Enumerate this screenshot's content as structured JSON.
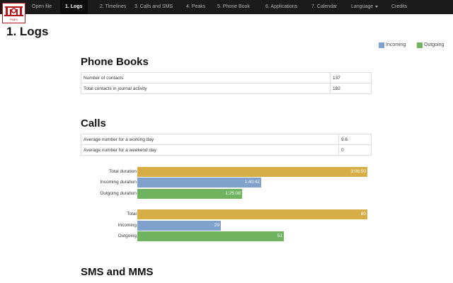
{
  "navbar": {
    "logo_text": "PhiEX",
    "items": [
      {
        "label": "Open file"
      },
      {
        "label": "1. Logs"
      },
      {
        "label": "2. Timelines"
      },
      {
        "label": "3. Calls and SMS"
      },
      {
        "label": "4. Peaks"
      },
      {
        "label": "5. Phone Book"
      },
      {
        "label": "6. Applications"
      },
      {
        "label": "7. Calendar"
      },
      {
        "label": "Language"
      },
      {
        "label": "Credits"
      }
    ],
    "active_index": 1
  },
  "page": {
    "title": "1. Logs"
  },
  "legend": {
    "items": [
      {
        "label": "Incoming",
        "color": "#7fa1cc"
      },
      {
        "label": "Outgoing",
        "color": "#6fb35f"
      }
    ]
  },
  "phone_books": {
    "heading": "Phone Books",
    "rows": [
      {
        "label": "Number of contacts",
        "value": "137"
      },
      {
        "label": "Total contacts in journal activity",
        "value": "182"
      }
    ]
  },
  "calls": {
    "heading": "Calls",
    "rows": [
      {
        "label": "Average number for a working day",
        "value": "9.6"
      },
      {
        "label": "Average number for a weekend day",
        "value": "0"
      }
    ],
    "duration_bars": [
      {
        "label": "Total duration",
        "value": "3:06:50",
        "fraction": 1.0,
        "color": "#d6ae45"
      },
      {
        "label": "Incoming duration",
        "value": "1:40:42",
        "fraction": 0.539,
        "color": "#7fa1cc"
      },
      {
        "label": "Outgoing duration",
        "value": "1:25:08",
        "fraction": 0.456,
        "color": "#6fb35f"
      }
    ],
    "count_bars": [
      {
        "label": "Total",
        "value": "80",
        "fraction": 1.0,
        "color": "#d6ae45"
      },
      {
        "label": "Incoming",
        "value": "29",
        "fraction": 0.3625,
        "color": "#7fa1cc"
      },
      {
        "label": "Outgoing",
        "value": "51",
        "fraction": 0.6375,
        "color": "#6fb35f"
      }
    ]
  },
  "sms": {
    "heading": "SMS and MMS"
  }
}
